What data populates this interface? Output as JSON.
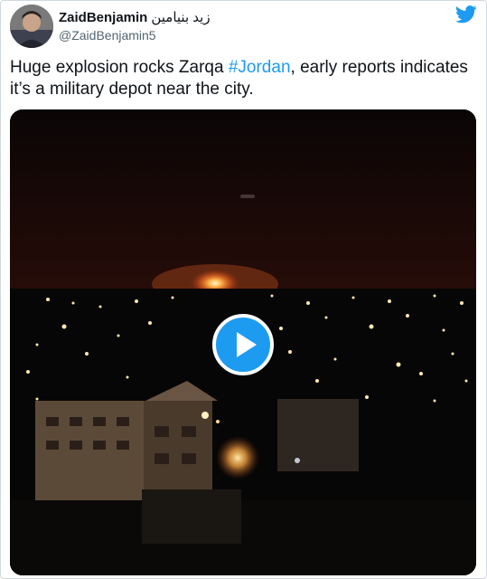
{
  "author": {
    "display_name": "ZaidBenjamin",
    "display_name_arabic": "زيد بنيامين",
    "handle": "@ZaidBenjamin5"
  },
  "tweet": {
    "text_before": "Huge explosion rocks Zarqa ",
    "hashtag": "#Jordan",
    "text_after": ", early reports indicates it’s a military depot near the city."
  },
  "media": {
    "type": "video",
    "play_icon": "play-icon"
  },
  "icons": {
    "brand": "twitter-bird-icon"
  },
  "colors": {
    "accent": "#1d9bf0",
    "text": "#0f1419",
    "secondary_text": "#536471"
  }
}
